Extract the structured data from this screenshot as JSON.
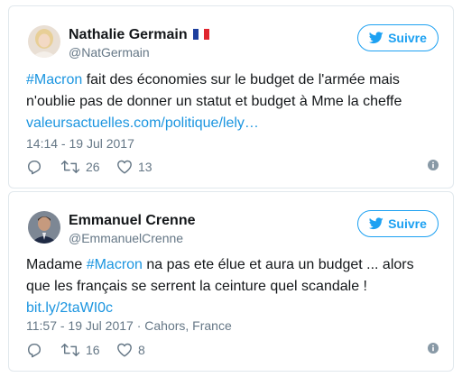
{
  "colors": {
    "link": "#1b95e0",
    "accent": "#1da1f2",
    "muted": "#657786",
    "border": "#e1e8ed"
  },
  "tweets": [
    {
      "author": "Nathalie Germain",
      "handle": "@NatGermain",
      "follow_label": "Suivre",
      "avatar_icon": "avatar-photo-woman",
      "flag_icon": "french-flag-icon",
      "text": {
        "hashtag": "#Macron",
        "line1_rest": " fait des économies sur le budget de l'armée mais",
        "line2": "n'oublie pas de donner un statut et budget à Mme la cheffe",
        "link": "valeursactuelles.com/politique/lely…"
      },
      "timestamp": "14:14 - 19 Jul 2017",
      "retweets": "26",
      "likes": "13"
    },
    {
      "author": "Emmanuel Crenne",
      "handle": "@EmmanuelCrenne",
      "follow_label": "Suivre",
      "avatar_icon": "avatar-photo-man",
      "text": {
        "prefix": "Madame ",
        "hashtag": "#Macron",
        "line1_rest": " na pas ete élue et aura un budget ... alors",
        "line2": "que les français se serrent la ceinture quel scandale !",
        "link": "bit.ly/2taWI0c"
      },
      "timestamp": "11:57 - 19 Jul 2017 · Cahors, France",
      "retweets": "16",
      "likes": "8"
    }
  ]
}
